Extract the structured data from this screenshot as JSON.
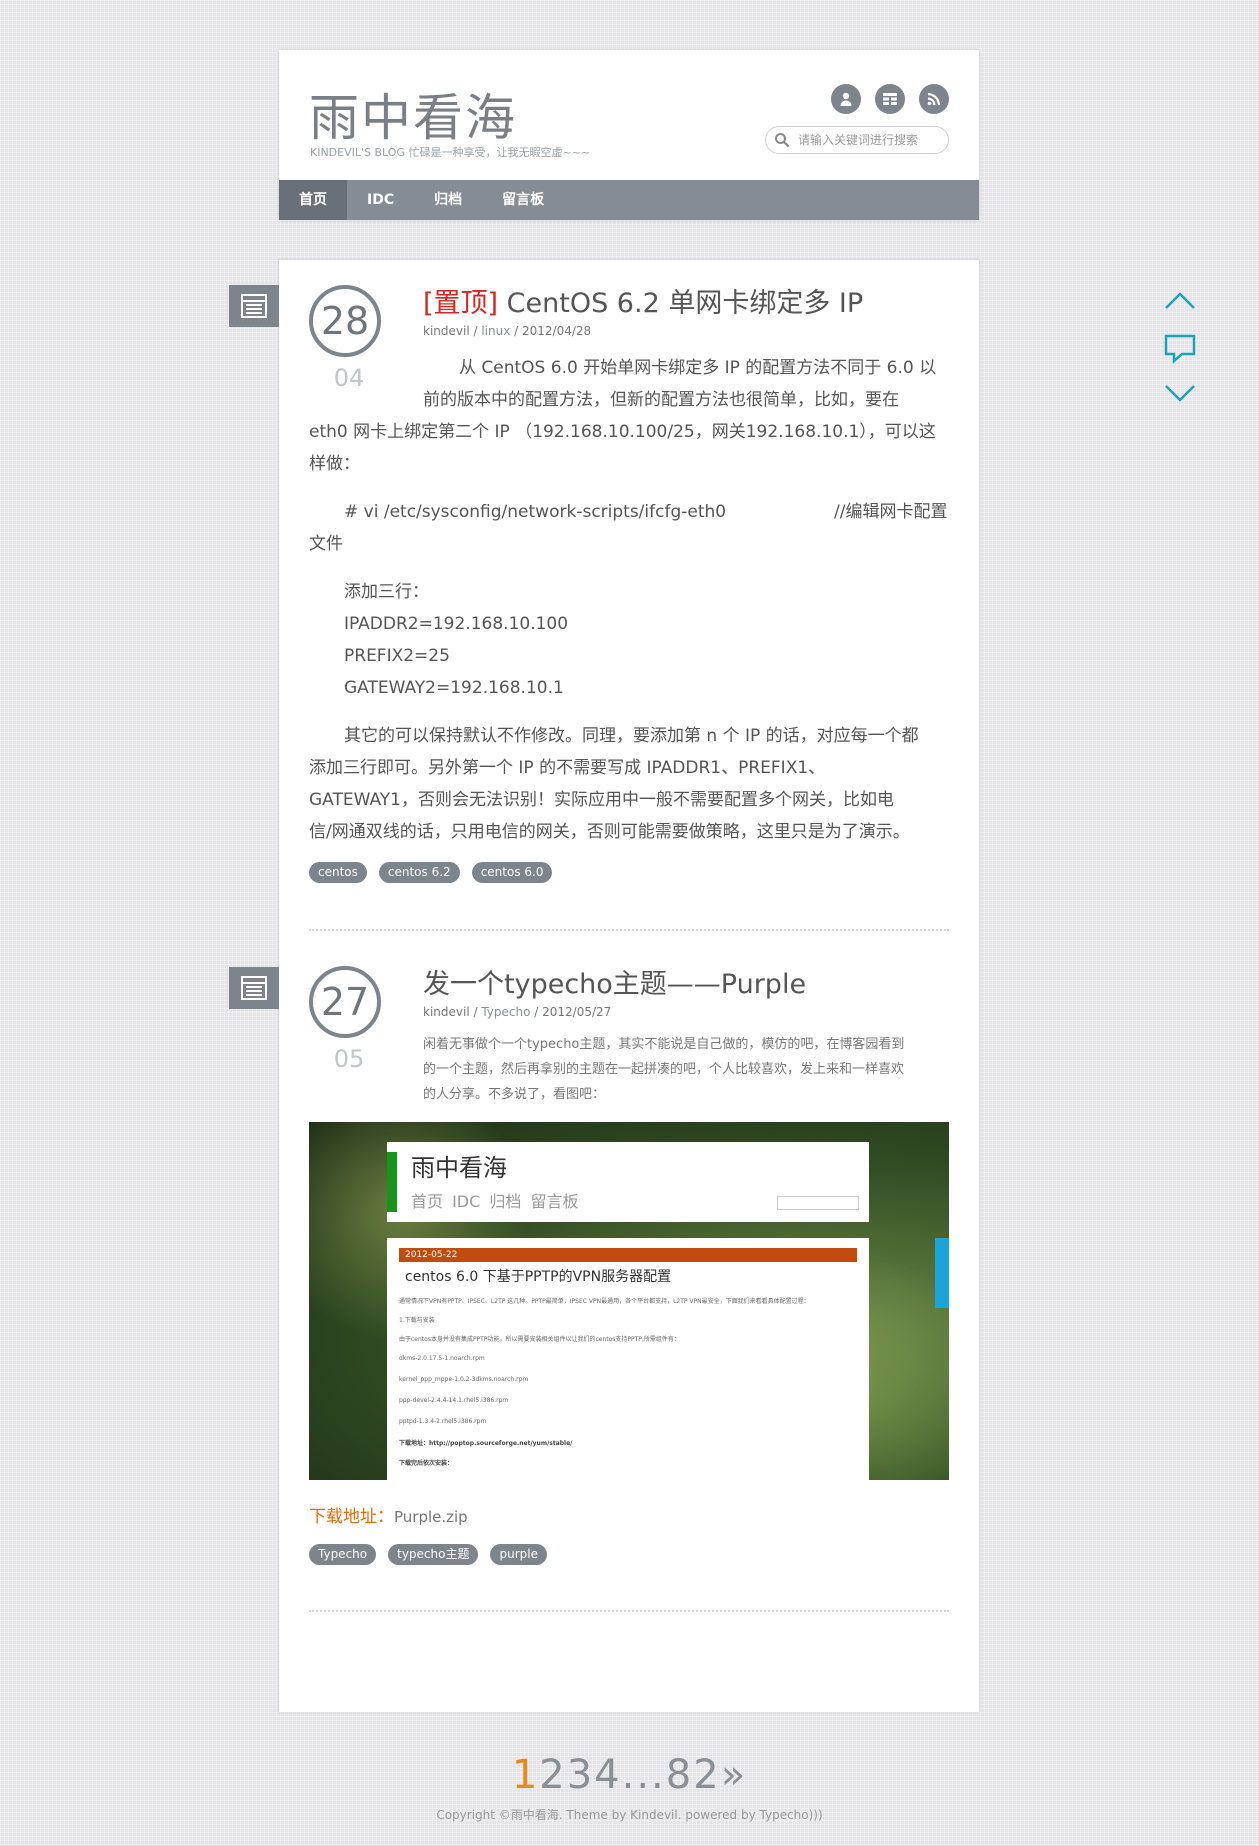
{
  "site": {
    "title": "雨中看海",
    "description": "KINDEVIL'S BLOG 忙碌是一种享受，让我无暇空虚~~~",
    "search_placeholder": "请输入关键词进行搜索",
    "icons": [
      "user-icon",
      "grid-icon",
      "rss-icon"
    ]
  },
  "nav": [
    "首页",
    "IDC",
    "归档",
    "留言板"
  ],
  "posts": [
    {
      "day": "28",
      "month": "04",
      "sticky_label": "[置顶]",
      "title": "CentOS 6.2 单网卡绑定多 IP",
      "author": "kindevil",
      "category": "linux",
      "date": "2012/04/28",
      "lines": [
        "从 CentOS 6.0 开始单网卡绑定多 IP 的配置方法不同于 6.0 以",
        "前的版本中的配置方法，但新的配置方法也很简单，比如，要在",
        "eth0 网卡上绑定第二个 IP （192.168.10.100/25，网关192.168.10.1），可以这",
        "样做：",
        "# vi   /etc/sysconfig/network-scripts/ifcfg-eth0",
        "//编辑网卡配置",
        "文件",
        "添加三行：",
        "IPADDR2=192.168.10.100",
        "PREFIX2=25",
        "GATEWAY2=192.168.10.1",
        "其它的可以保持默认不作修改。同理，要添加第 n 个 IP 的话，对应每一个都",
        "添加三行即可。另外第一个 IP 的不需要写成 IPADDR1、PREFIX1、",
        "GATEWAY1，否则会无法识别！实际应用中一般不需要配置多个网关，比如电",
        "信/网通双线的话，只用电信的网关，否则可能需要做策略，这里只是为了演示。"
      ],
      "tags": [
        "centos",
        "centos 6.2",
        "centos 6.0"
      ]
    },
    {
      "day": "27",
      "month": "05",
      "title": "发一个typecho主题——Purple",
      "author": "kindevil",
      "category": "Typecho",
      "date": "2012/05/27",
      "lines": [
        "闲着无事做个一个typecho主题，其实不能说是自己做的，模仿的吧，在博客园看到",
        "的一个主题，然后再拿别的主题在一起拼凑的吧，个人比较喜欢，发上来和一样喜欢",
        "的人分享。不多说了，看图吧："
      ],
      "preview": {
        "title": "雨中看海",
        "nav": "首页 IDC 归档 留言板",
        "date": "2012-05-22",
        "post_title": "centos 6.0 下基于PPTP的VPN服务器配置",
        "lines": [
          "通常情况下VPN有PPTP、IPSEC、L2TP 这几种。PPTP最简单，IPSEC VPN最通用，各个平台都支持，L2TP VPN最安全，下面我们来看看具体配置过程：",
          "1.下载与安装",
          "由于centos本身并没有集成PPTP功能，所以需要安装相关组件以让我们的centos支持PPTP,所需组件有：",
          "dkms-2.0.17.5-1.noarch.rpm",
          "kernel_ppp_mppe-1.0.2-3dkms.noarch.rpm",
          "ppp-devel-2.4.4-14.1.rhel5.i386.rpm",
          "pptpd-1.3.4-2.rhel5.i386.rpm",
          "下载地址：http://poptop.sourceforge.net/yum/stable/",
          "下载完后依次安装："
        ]
      },
      "download_label": "下载地址：",
      "download_file": "Purple.zip",
      "tags": [
        "Typecho",
        "typecho主题",
        "purple"
      ]
    }
  ],
  "pager": {
    "current": "1",
    "pages": "234",
    "ellipsis": "...",
    "last": "82",
    "next": "»"
  },
  "copyright": "Copyright ©雨中看海. Theme by Kindevil. powered by Typecho)))",
  "colors": {
    "accent_gray": "#7d848b",
    "sticky_red": "#d9251c",
    "download_orange": "#e36c0a",
    "float_teal": "#1aa4b4",
    "pager_current": "#e38c1c"
  }
}
